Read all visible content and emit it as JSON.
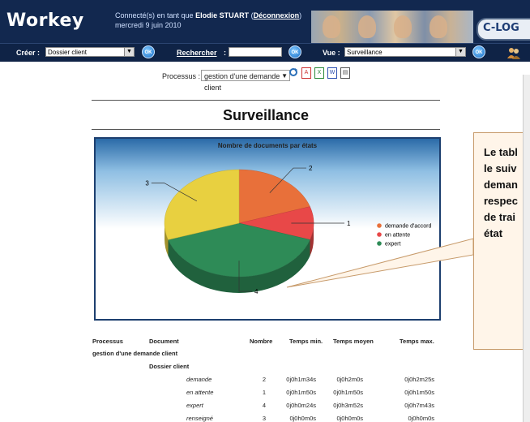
{
  "app": {
    "name": "Workey",
    "brand": "C-LOG"
  },
  "connection": {
    "prefix": "Connecté(s) en tant que",
    "user": "Elodie STUART",
    "open": "(",
    "logout": "Déconnexion",
    "close": ")",
    "date": "mercredi 9 juin 2010"
  },
  "toolbar": {
    "create_label": "Créer :",
    "create_value": "Dossier client",
    "search_label": "Rechercher",
    "search_colon": ":",
    "view_label": "Vue :",
    "view_value": "Surveillance",
    "ok": "OK"
  },
  "process": {
    "label": "Processus :",
    "value": "gestion d'une demande client"
  },
  "page_title": "Surveillance",
  "chart_data": {
    "type": "pie",
    "title": "Nombre de documents par états",
    "categories": [
      "demande d'accord",
      "en attente",
      "expert",
      "renseigné"
    ],
    "values": [
      2,
      1,
      4,
      3
    ],
    "legend_visible": [
      "demande d'accord",
      "en attente",
      "expert"
    ],
    "colors": [
      "#e8703a",
      "#e84848",
      "#2e8b57",
      "#e8d040"
    ],
    "legend_position": "right",
    "three_d": true
  },
  "callout_lines": [
    "Le tabl",
    "le suiv",
    "deman",
    "respec",
    "de trai",
    "état"
  ],
  "table": {
    "headers": [
      "Processus",
      "Document",
      "Nombre",
      "Temps min.",
      "Temps moyen",
      "Temps max."
    ],
    "process": "gestion d'une demande client",
    "document": "Dossier client",
    "rows": [
      {
        "state": "demande",
        "count": "2",
        "min": "0j0h1m34s",
        "avg": "0j0h2m0s",
        "max": "0j0h2m25s"
      },
      {
        "state": "en attente",
        "count": "1",
        "min": "0j0h1m50s",
        "avg": "0j0h1m50s",
        "max": "0j0h1m50s"
      },
      {
        "state": "expert",
        "count": "4",
        "min": "0j0h0m24s",
        "avg": "0j0h3m52s",
        "max": "0j0h7m43s"
      },
      {
        "state": "renseigné",
        "count": "3",
        "min": "0j0h0m0s",
        "avg": "0j0h0m0s",
        "max": "0j0h0m0s"
      }
    ]
  }
}
